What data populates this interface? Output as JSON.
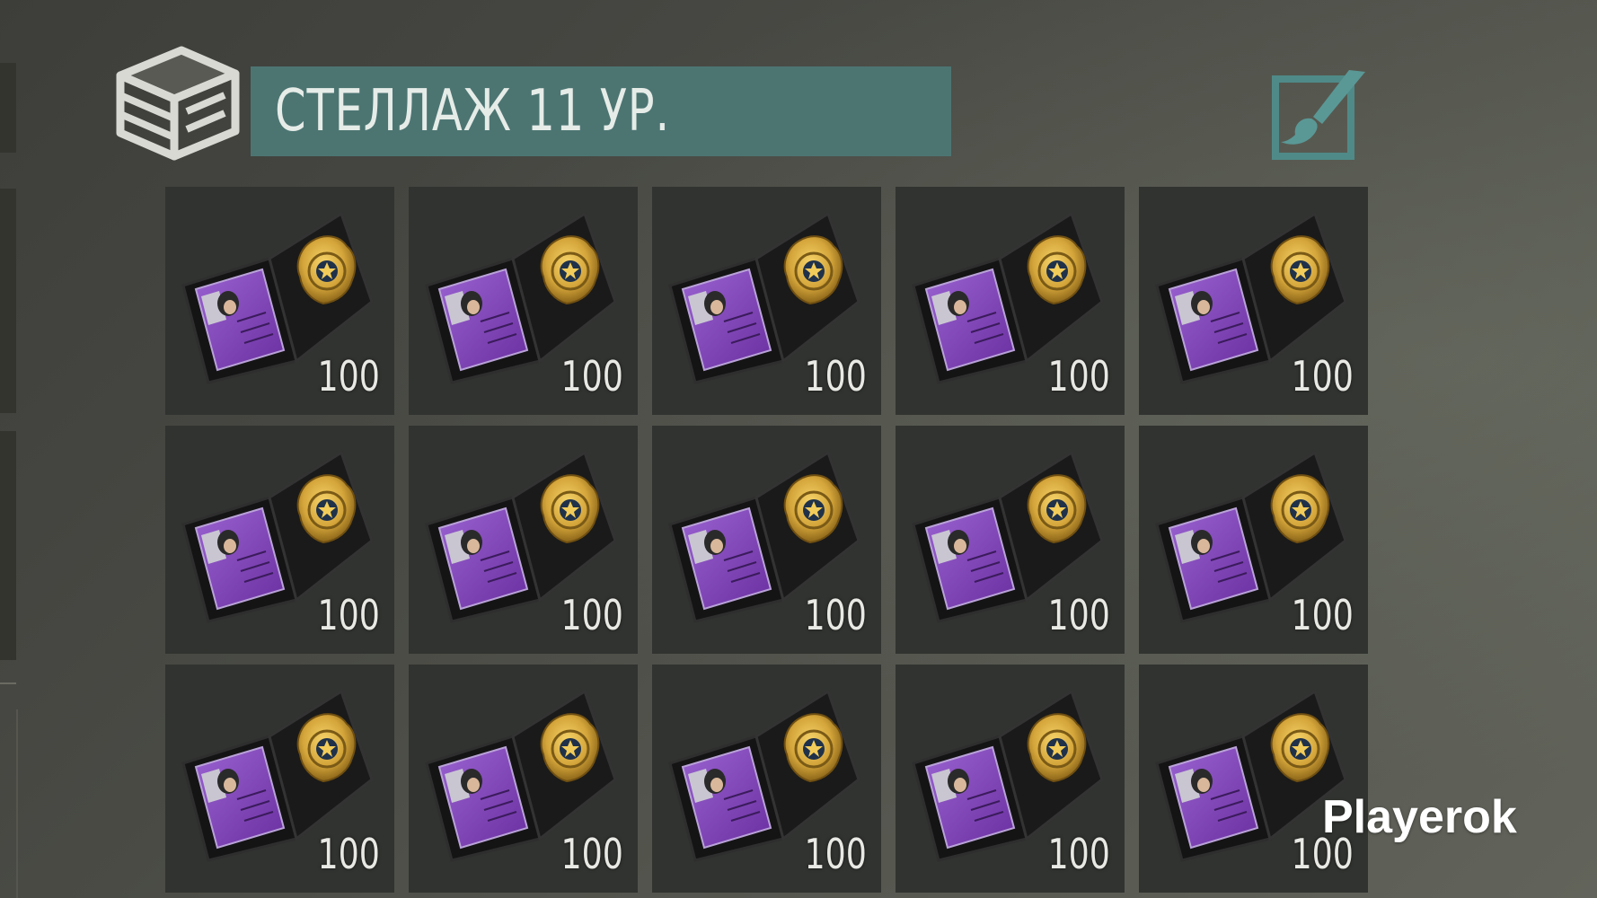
{
  "container": {
    "title": "СТЕЛЛАЖ 11 УР.",
    "icon": "storage-box-icon",
    "edit_icon": "paint-brush-edit-icon"
  },
  "colors": {
    "title_bar": "#4c7572",
    "accent": "#4f8a88",
    "slot_bg": "#313330",
    "badge_gold": "#d4a53a",
    "id_card_purple": "#7b3fb0"
  },
  "slots": [
    {
      "item": "police-badge-wallet-icon",
      "quantity": "100"
    },
    {
      "item": "police-badge-wallet-icon",
      "quantity": "100"
    },
    {
      "item": "police-badge-wallet-icon",
      "quantity": "100"
    },
    {
      "item": "police-badge-wallet-icon",
      "quantity": "100"
    },
    {
      "item": "police-badge-wallet-icon",
      "quantity": "100"
    },
    {
      "item": "police-badge-wallet-icon",
      "quantity": "100"
    },
    {
      "item": "police-badge-wallet-icon",
      "quantity": "100"
    },
    {
      "item": "police-badge-wallet-icon",
      "quantity": "100"
    },
    {
      "item": "police-badge-wallet-icon",
      "quantity": "100"
    },
    {
      "item": "police-badge-wallet-icon",
      "quantity": "100"
    },
    {
      "item": "police-badge-wallet-icon",
      "quantity": "100"
    },
    {
      "item": "police-badge-wallet-icon",
      "quantity": "100"
    },
    {
      "item": "police-badge-wallet-icon",
      "quantity": "100"
    },
    {
      "item": "police-badge-wallet-icon",
      "quantity": "100"
    },
    {
      "item": "police-badge-wallet-icon",
      "quantity": "100"
    }
  ],
  "watermark": "Playerok"
}
